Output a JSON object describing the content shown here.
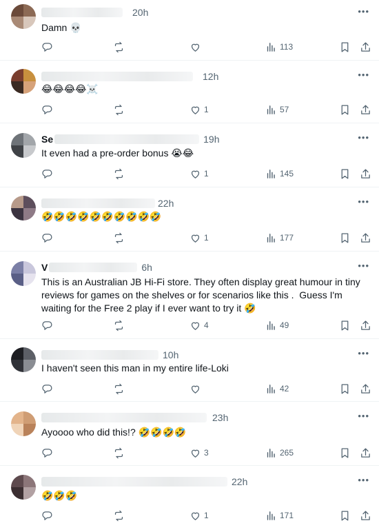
{
  "posts": [
    {
      "name": "",
      "time": "20h",
      "text": "Damn 💀",
      "replies": "",
      "likes": "",
      "views": "113",
      "avatar_colors": [
        "#6b4a3a",
        "#8c6a55",
        "#a98a76",
        "#d8c7bb"
      ]
    },
    {
      "name": "",
      "time": "12h",
      "text": "😂😂😂😂☠️",
      "replies": "",
      "likes": "1",
      "views": "57",
      "avatar_colors": [
        "#7a3e2e",
        "#c8903e",
        "#3b2a22",
        "#d6a27a"
      ]
    },
    {
      "name": "Se",
      "time": "19h",
      "text": "It even had a pre-order bonus 😭😂",
      "replies": "",
      "likes": "1",
      "views": "145",
      "avatar_colors": [
        "#6e7378",
        "#a2a6aa",
        "#3f4246",
        "#c7c9cc"
      ]
    },
    {
      "name": "",
      "time": "22h",
      "text": "🤣🤣🤣🤣🤣🤣🤣🤣🤣🤣",
      "replies": "",
      "likes": "1",
      "views": "177",
      "avatar_colors": [
        "#b79a8a",
        "#5d4e5c",
        "#3b3340",
        "#8e7a86"
      ]
    },
    {
      "name": "V",
      "time": "6h",
      "text": "This is an Australian JB Hi-Fi store. They often display great humour in tiny\nreviews for games on the shelves or for scenarios like this .  Guess I'm\nwaiting for the Free 2 play if I ever want to try it 🤣",
      "replies": "",
      "likes": "4",
      "views": "49",
      "avatar_colors": [
        "#7b7fa6",
        "#c9c7dc",
        "#5a5f86",
        "#e6e3ee"
      ]
    },
    {
      "name": "",
      "time": "10h",
      "text": "I haven't seen this man in my entire life-Loki",
      "replies": "",
      "likes": "",
      "views": "42",
      "avatar_colors": [
        "#1d1e22",
        "#5c5f66",
        "#303238",
        "#8a8d93"
      ]
    },
    {
      "name": "",
      "time": "23h",
      "text": "Ayoooo who did this!? 🤣🤣🤣🤣",
      "replies": "",
      "likes": "3",
      "views": "265",
      "avatar_colors": [
        "#e3b48b",
        "#cf9d74",
        "#f0d4b8",
        "#b9825a"
      ]
    },
    {
      "name": "",
      "time": "22h",
      "text": "🤣🤣🤣",
      "replies": "",
      "likes": "1",
      "views": "171",
      "avatar_colors": [
        "#5e4a4e",
        "#8c7679",
        "#3b2e31",
        "#b2a1a3"
      ]
    }
  ]
}
